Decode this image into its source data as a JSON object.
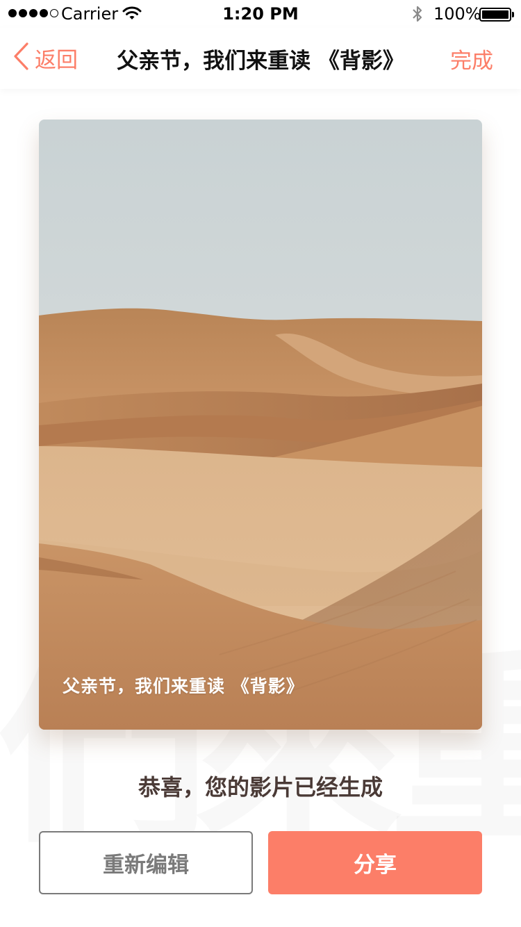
{
  "status_bar": {
    "carrier": "Carrier",
    "time": "1:20 PM",
    "battery": "100%"
  },
  "nav": {
    "back_label": "返回",
    "title": "父亲节，我们来重读 《背影》",
    "done_label": "完成"
  },
  "card": {
    "caption": "父亲节，我们来重读 《背影》"
  },
  "success_message": "恭喜，您的影片已经生成",
  "actions": {
    "edit_label": "重新编辑",
    "share_label": "分享"
  },
  "colors": {
    "accent": "#fc7e68",
    "edit_border": "#7a7a7a",
    "success_text": "#4a3a36"
  }
}
